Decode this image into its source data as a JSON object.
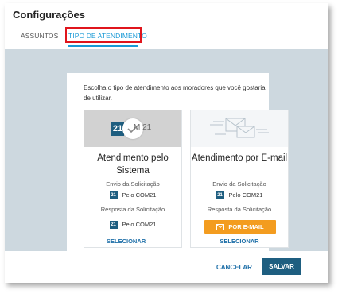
{
  "window": {
    "title": "Configurações"
  },
  "tabs": [
    {
      "label": "ASSUNTOS"
    },
    {
      "label": "TIPO DE ATENDIMENTO"
    }
  ],
  "intro": "Escolha o tipo de atendimento aos moradores que você gostaria de utilizar.",
  "options": [
    {
      "title": "Atendimento pelo Sistema",
      "logo_mark": "21",
      "logo_text": "M 21",
      "envio_label": "Envio da Solicitação",
      "envio_value": "Pelo COM21",
      "resposta_label": "Resposta da Solicitação",
      "resposta_value": "Pelo COM21",
      "select_label": "SELECIONAR"
    },
    {
      "title": "Atendimento por E-mail",
      "envio_label": "Envio da Solicitação",
      "envio_value": "Pelo COM21",
      "resposta_label": "Resposta da Solicitação",
      "resposta_button": "POR E-MAIL",
      "select_label": "SELECIONAR"
    }
  ],
  "footer": {
    "cancel": "CANCELAR",
    "save": "SALVAR"
  },
  "colors": {
    "accent": "#1a9ad6",
    "primary": "#1e5e80",
    "email_button": "#f39c1f",
    "highlight": "#e0151c"
  }
}
